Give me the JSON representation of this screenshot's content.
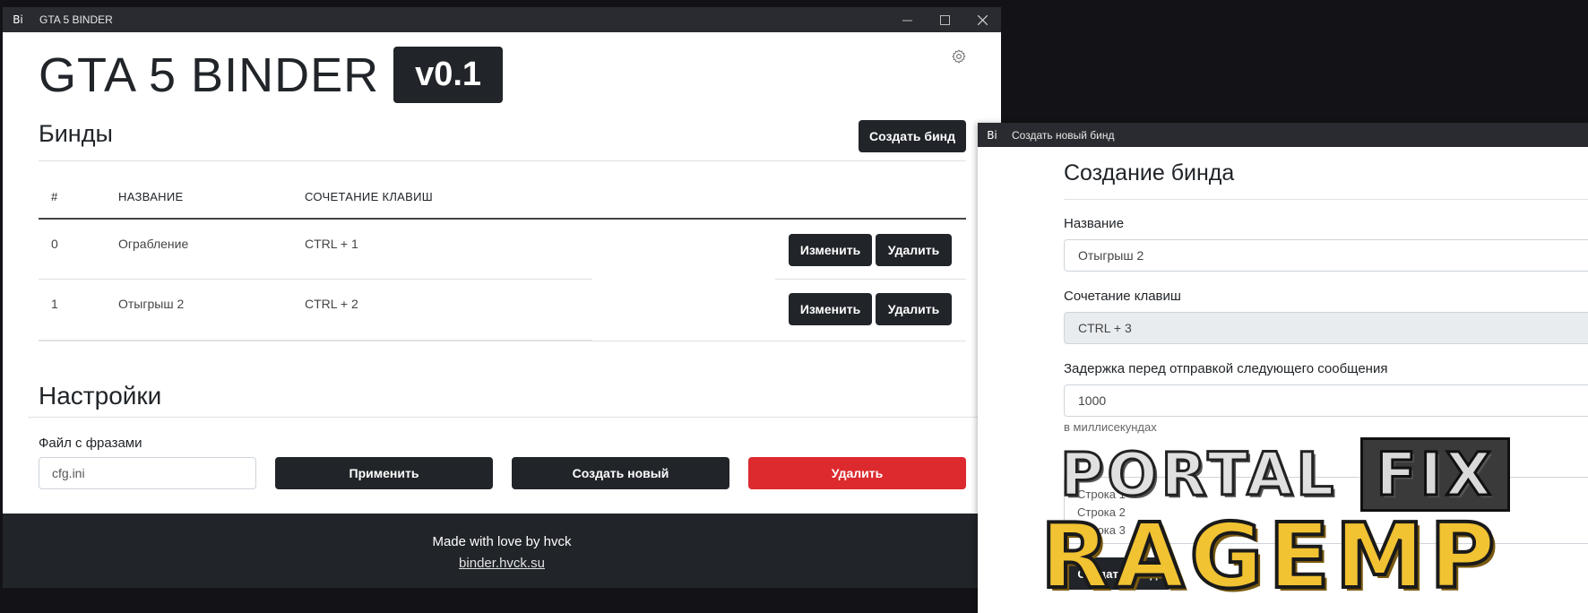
{
  "main_window": {
    "window_title": "GTA 5 BINDER",
    "app_icon_text": "Bi",
    "app_title": "GTA 5 BINDER",
    "version": "v0.1",
    "binds_section": {
      "title": "Бинды",
      "create_button": "Создать бинд",
      "columns": [
        "#",
        "НАЗВАНИЕ",
        "СОЧЕТАНИЕ КЛАВИШ"
      ],
      "rows": [
        {
          "index": "0",
          "name": "Ограбление",
          "hotkey": "CTRL + 1",
          "edit_label": "Изменить",
          "delete_label": "Удалить"
        },
        {
          "index": "1",
          "name": "Отыгрыш 2",
          "hotkey": "CTRL + 2",
          "edit_label": "Изменить",
          "delete_label": "Удалить"
        }
      ]
    },
    "settings_section": {
      "title": "Настройки",
      "file_label": "Файл с фразами",
      "file_value": "cfg.ini",
      "apply_button": "Применить",
      "create_new_button": "Создать новый",
      "delete_button": "Удалить"
    },
    "footer": {
      "text": "Made with love by hvck",
      "link": "binder.hvck.su"
    }
  },
  "dialog_window": {
    "window_title": "Создать новый бинд",
    "app_icon_text": "Bi",
    "heading": "Создание бинда",
    "name_label": "Название",
    "name_value": "Отыгрыш 2",
    "hotkey_label": "Сочетание клавиш",
    "hotkey_value": "CTRL + 3",
    "delay_label": "Задержка перед отправкой следующего сообщения",
    "delay_value": "1000",
    "delay_help": "в миллисекундах",
    "lines": [
      "Строка 1",
      "Строка 2",
      "Строка 3"
    ],
    "submit_button": "Создать бинд"
  },
  "watermark": {
    "line1": "PORTAL",
    "line1_box": "FIX",
    "line2": "RAGEMP"
  },
  "colors": {
    "titlebar": "#2a2b30",
    "dark_button": "#212529",
    "danger_button": "#dc2a2e",
    "watermark_gold": "#f1c232"
  }
}
